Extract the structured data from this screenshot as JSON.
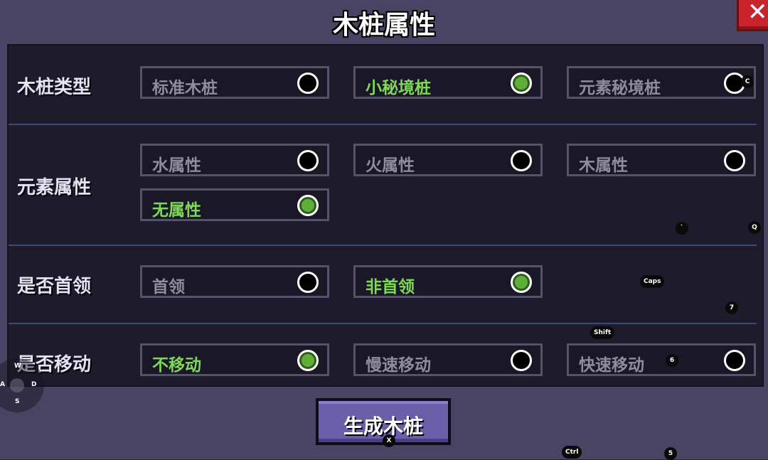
{
  "title": "木桩属性",
  "close_icon": "close-x-icon",
  "rows": [
    {
      "label": "木桩类型",
      "options": [
        {
          "label": "标准木桩",
          "selected": false
        },
        {
          "label": "小秘境桩",
          "selected": true
        },
        {
          "label": "元素秘境桩",
          "selected": false
        }
      ]
    },
    {
      "label": "元素属性",
      "options": [
        {
          "label": "水属性",
          "selected": false
        },
        {
          "label": "火属性",
          "selected": false
        },
        {
          "label": "木属性",
          "selected": false
        },
        {
          "label": "无属性",
          "selected": true
        }
      ]
    },
    {
      "label": "是否首领",
      "options": [
        {
          "label": "首领",
          "selected": false
        },
        {
          "label": "非首领",
          "selected": true
        }
      ]
    },
    {
      "label": "是否移动",
      "options": [
        {
          "label": "不移动",
          "selected": true
        },
        {
          "label": "慢速移动",
          "selected": false
        },
        {
          "label": "快速移动",
          "selected": false
        }
      ]
    }
  ],
  "generate_button": "生成木桩",
  "key_hints": {
    "c": "C",
    "backtick": "`",
    "q": "Q",
    "caps": "Caps",
    "seven": "7",
    "shift": "Shift",
    "six": "6",
    "x": "X",
    "ctrl": "Ctrl",
    "five": "5"
  },
  "joystick": {
    "w": "W",
    "a": "A",
    "s": "S",
    "d": "D"
  },
  "colors": {
    "selected_text": "#7ed957",
    "panel": "#1e1c2c",
    "frame": "#4a4464",
    "close": "#c9232b"
  }
}
